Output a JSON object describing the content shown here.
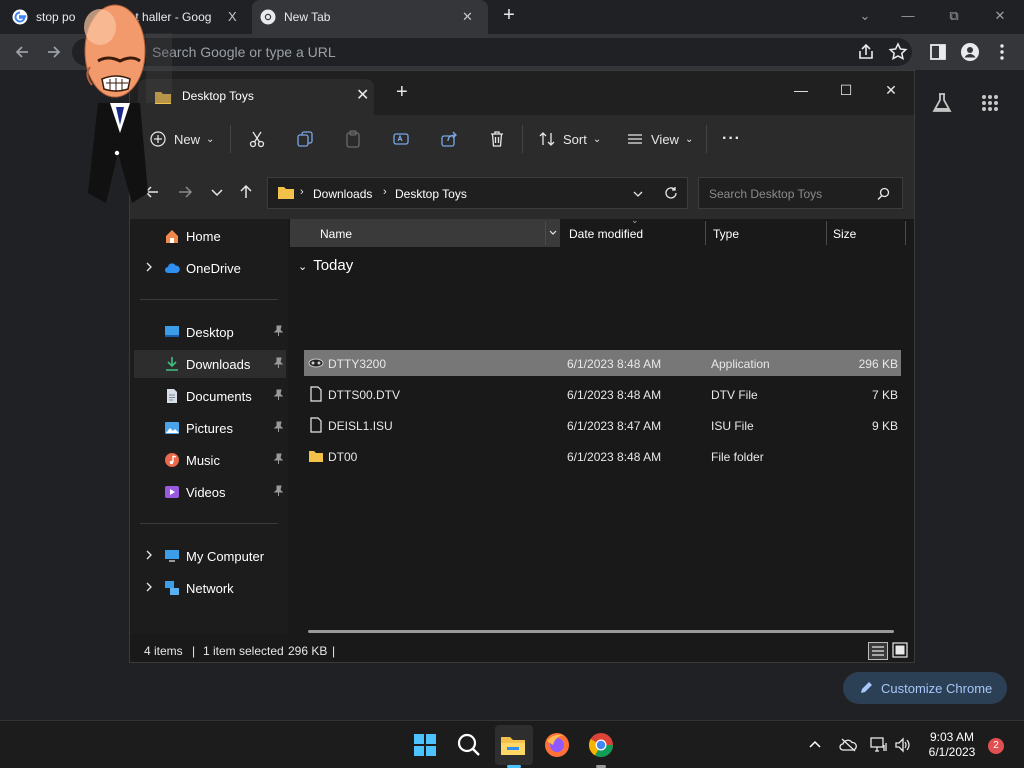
{
  "browser": {
    "tabs": [
      {
        "title_left": "stop po",
        "title_right": "t haller - Goog",
        "close": "X"
      },
      {
        "title": "New Tab",
        "close": "✕"
      }
    ],
    "new_tab": "+",
    "omnibox_placeholder": "Search Google or type a URL"
  },
  "explorer": {
    "tab_title": "Desktop Toys",
    "new_tab": "+",
    "commands": {
      "new": "New",
      "sort": "Sort",
      "view": "View",
      "more": "···"
    },
    "breadcrumb": [
      "Downloads",
      "Desktop Toys"
    ],
    "search_placeholder": "Search Desktop Toys",
    "nav": {
      "home": "Home",
      "onedrive": "OneDrive",
      "desktop": "Desktop",
      "downloads": "Downloads",
      "documents": "Documents",
      "pictures": "Pictures",
      "music": "Music",
      "videos": "Videos",
      "my_computer": "My Computer",
      "network": "Network"
    },
    "columns": {
      "name": "Name",
      "date": "Date modified",
      "type": "Type",
      "size": "Size"
    },
    "group": "Today",
    "files": [
      {
        "name": "DTTY3200",
        "date": "6/1/2023 8:48 AM",
        "type": "Application",
        "size": "296 KB",
        "icon": "application-icon"
      },
      {
        "name": "DTTS00.DTV",
        "date": "6/1/2023 8:48 AM",
        "type": "DTV File",
        "size": "7 KB",
        "icon": "file-icon"
      },
      {
        "name": "DEISL1.ISU",
        "date": "6/1/2023 8:47 AM",
        "type": "ISU File",
        "size": "9 KB",
        "icon": "file-icon"
      },
      {
        "name": "DT00",
        "date": "6/1/2023 8:48 AM",
        "type": "File folder",
        "size": "",
        "icon": "folder-icon"
      }
    ],
    "status": {
      "items": "4 items",
      "sep": "|",
      "selected": "1 item selected",
      "selected_size": "296 KB",
      "sep2": "|"
    }
  },
  "customize_chrome": "Customize Chrome",
  "taskbar": {
    "time": "9:03 AM",
    "date": "6/1/2023",
    "notifications": "2"
  },
  "colors": {
    "accent_blue": "#a8c7fa",
    "folder_yellow": "#f3c14a",
    "selection_gray": "#777777"
  }
}
